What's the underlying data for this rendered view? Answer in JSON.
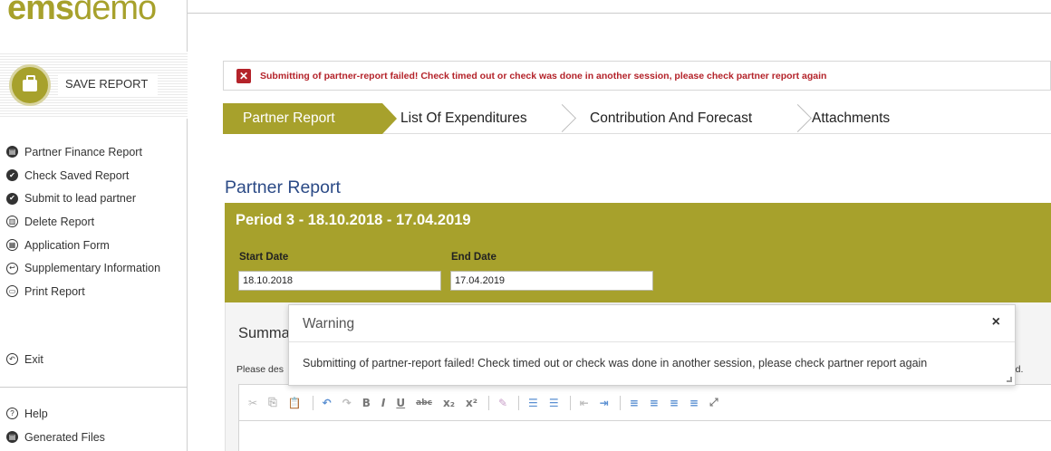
{
  "app": {
    "logo_ems": "ems",
    "logo_demo": "demo"
  },
  "sidebar": {
    "save_label": "SAVE REPORT",
    "items": [
      {
        "label": "Partner Finance Report",
        "icon": "report-icon"
      },
      {
        "label": "Check Saved Report",
        "icon": "check-icon"
      },
      {
        "label": "Submit to lead partner",
        "icon": "submit-icon"
      },
      {
        "label": "Delete Report",
        "icon": "trash-icon"
      },
      {
        "label": "Application Form",
        "icon": "form-icon"
      },
      {
        "label": "Supplementary Information",
        "icon": "info-icon"
      },
      {
        "label": "Print Report",
        "icon": "print-icon"
      }
    ],
    "exit_label": "Exit",
    "help_label": "Help",
    "generated_files_label": "Generated Files"
  },
  "alert": {
    "text": "Submitting of partner-report failed! Check timed out or check was done in another session, please check partner report again"
  },
  "tabs": [
    {
      "label": "Partner Report",
      "active": true
    },
    {
      "label": "List Of Expenditures",
      "active": false
    },
    {
      "label": "Contribution And Forecast",
      "active": false
    },
    {
      "label": "Attachments",
      "active": false
    }
  ],
  "page": {
    "title": "Partner Report",
    "period_title": "Period 3 - 18.10.2018 - 17.04.2019",
    "start_date_label": "Start Date",
    "start_date_value": "18.10.2018",
    "end_date_label": "End Date",
    "end_date_value": "17.04.2019",
    "summary_title": "Summa",
    "description_start": "Please des",
    "description_end": "riod."
  },
  "modal": {
    "title": "Warning",
    "close": "×",
    "message": "Submitting of partner-report failed! Check timed out or check was done in another session, please check partner report again"
  },
  "colors": {
    "brand": "#a7a12c",
    "alert": "#b4232a",
    "title_blue": "#2b4a86"
  }
}
